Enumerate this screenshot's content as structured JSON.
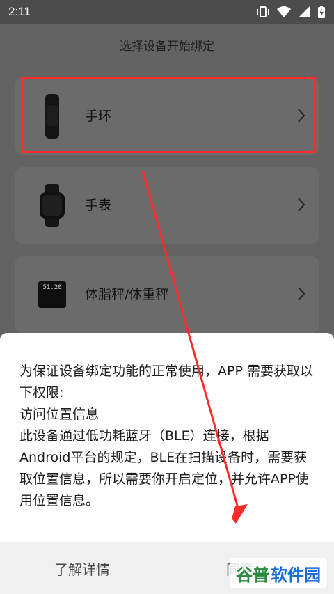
{
  "status_bar": {
    "time": "2:11"
  },
  "page": {
    "title": "选择设备开始绑定"
  },
  "devices": [
    {
      "label": "手环"
    },
    {
      "label": "手表"
    },
    {
      "label": "体脂秤/体重秤",
      "screen_text": "51.20"
    }
  ],
  "dialog": {
    "lines": [
      "为保证设备绑定功能的正常使用，APP 需要获取以下权限:",
      "访问位置信息",
      "此设备通过低功耗蓝牙（BLE）连接，根据Android平台的规定，BLE在扫描设备时，需要获取位置信息，所以需要你开启定位，并允许APP使用位置信息。"
    ],
    "details_label": "了解详情",
    "agree_label": "同意"
  },
  "watermark": {
    "part1": "谷普",
    "part2": "软件园"
  },
  "colors": {
    "annotation": "#ff2a2a",
    "watermark_green": "#2b8a3e",
    "watermark_blue": "#1a6ed8"
  }
}
